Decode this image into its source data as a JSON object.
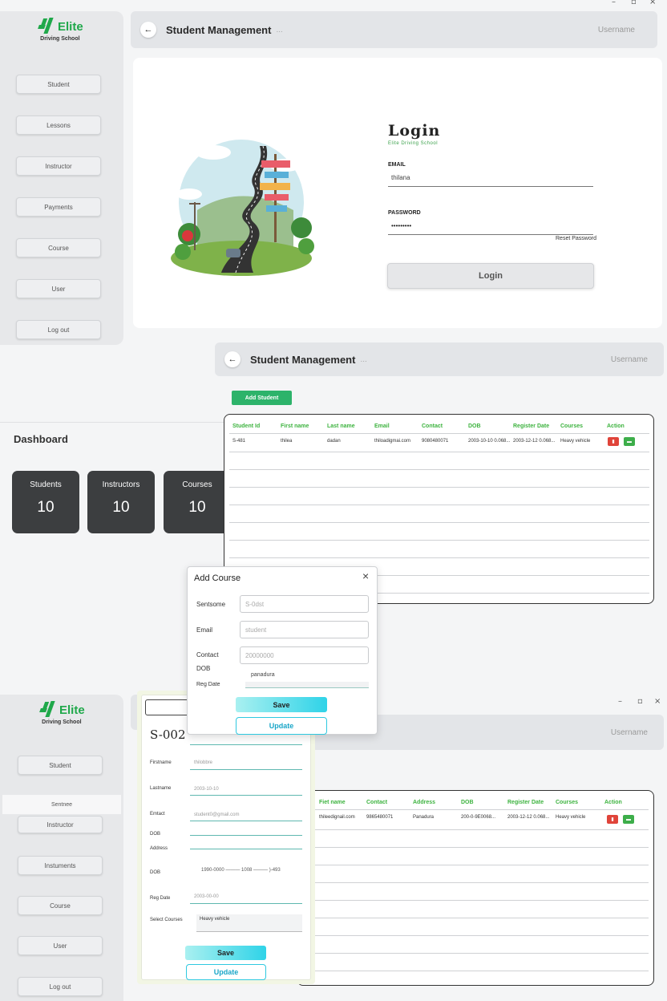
{
  "window_controls": {
    "minimize": "–",
    "restore": "▫",
    "close": "×"
  },
  "logo": {
    "name": "Elite",
    "subtitle": "Driving School"
  },
  "sidebar_top": {
    "items": [
      "Student",
      "Lessons",
      "Instructor",
      "Payments",
      "Course",
      "User",
      "Log out"
    ]
  },
  "header_top": {
    "title": "Student Management",
    "dots": "...",
    "user": "Username"
  },
  "login": {
    "title": "Login",
    "subtitle": "Elite Driving School",
    "email_label": "EMAIL",
    "email_value": "thilana",
    "password_label": "PASSWORD",
    "password_value": "•••••••••",
    "reset_link": "Reset Password",
    "button": "Login"
  },
  "header_mid": {
    "title": "Student Management",
    "dots": "...",
    "user": "Username"
  },
  "add_student_button": "Add Student",
  "dashboard": {
    "title": "Dashboard",
    "stats": [
      {
        "label": "Students",
        "value": "10"
      },
      {
        "label": "Instructors",
        "value": "10"
      },
      {
        "label": "Courses",
        "value": "10"
      }
    ]
  },
  "table_top": {
    "headers": [
      "Student Id",
      "First name",
      "Last name",
      "Email",
      "Contact",
      "DOB",
      "Register Date",
      "Courses",
      "Action"
    ],
    "rows": [
      [
        "S-481",
        "thilea",
        "dadan",
        "thiloadigmai.com",
        "9080480071",
        "2003-10-10 0.068...",
        "2003-12-12 0.068...",
        "Heavy vehicle"
      ]
    ]
  },
  "add_course_dialog": {
    "title": "Add Course",
    "close": "×",
    "fields": [
      {
        "label": "Sentsome",
        "placeholder": "S-0dst"
      },
      {
        "label": "Email",
        "placeholder": "student"
      },
      {
        "label": "Contact",
        "placeholder": "20000000"
      }
    ],
    "dob_label": "DOB",
    "reg_label": "Reg Date",
    "reg_value": "panadura",
    "save": "Save",
    "update": "Update"
  },
  "logo_bottom": {
    "name": "Elite",
    "subtitle": "Driving School"
  },
  "sidebar_bottom": {
    "items": [
      "Student",
      "Sentnee",
      "Instructor",
      "Instuments",
      "Course",
      "User",
      "Log out"
    ]
  },
  "header_bottom": {
    "user": "Username"
  },
  "student_form": {
    "id": "S-002",
    "fields": [
      {
        "label": "Firstname",
        "value": "thilobbre"
      },
      {
        "label": "Lastname",
        "value": "2003-10-10"
      },
      {
        "label": "Emtact",
        "value": "student0@gmail.com"
      },
      {
        "label": "DOB",
        "value": ""
      },
      {
        "label": "Address",
        "value": ""
      },
      {
        "label": "DOB",
        "value": "1990-0000 ——— 1008 ——— )-493"
      },
      {
        "label": "Reg Date",
        "value": "2003-00-00"
      },
      {
        "label": "Select Courses",
        "value": "Heavy vehicle"
      }
    ],
    "save": "Save",
    "update": "Update"
  },
  "table_bottom": {
    "headers": [
      "Fiet name",
      "Contact",
      "Address",
      "DOB",
      "Register Date",
      "Courses",
      "Action"
    ],
    "rows": [
      [
        "thileedignail.com",
        "9865480071",
        "Panadura",
        "200-0-9E0068...",
        "2003-12-12 0.068...",
        "Heavy vehicle"
      ]
    ]
  },
  "colors": {
    "accent_green": "#3db33f",
    "delete_red": "#e0443a",
    "edit_green": "#3dae4a",
    "save_cyan": "#2fd3e8"
  }
}
